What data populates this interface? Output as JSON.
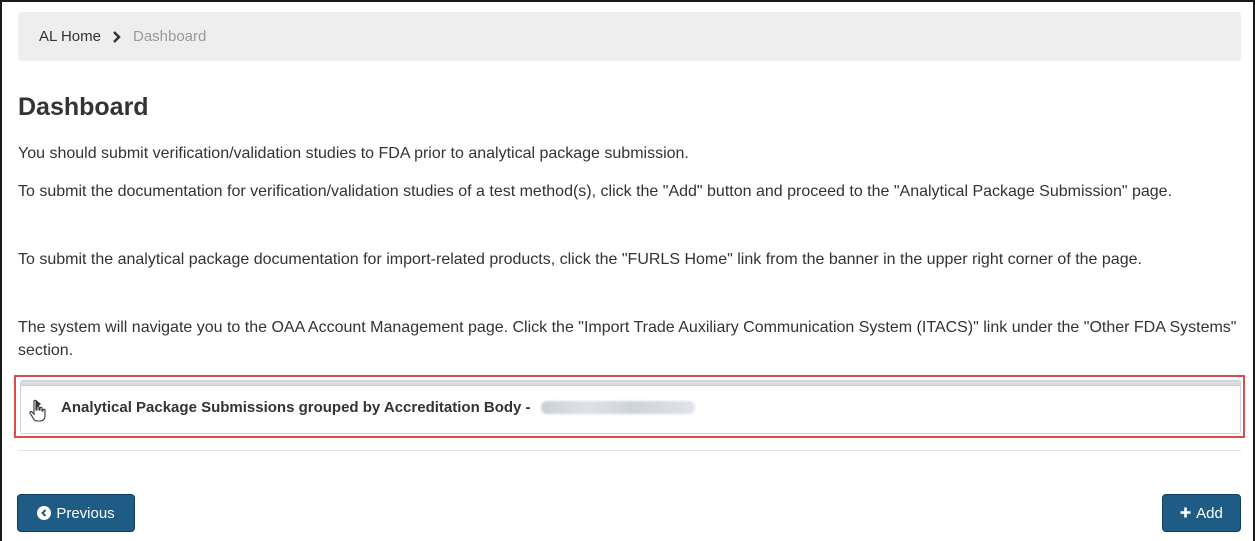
{
  "breadcrumb": {
    "home": "AL Home",
    "current": "Dashboard"
  },
  "page": {
    "title": "Dashboard",
    "paragraphs": [
      "You should submit verification/validation studies to FDA prior to analytical package submission.",
      "To submit the documentation for verification/validation studies of a test method(s), click the \"Add\" button and proceed to the \"Analytical Package Submission\" page.",
      "To submit the analytical package documentation for import-related products, click the \"FURLS Home\" link from the banner in the upper right corner of the page.",
      "The system will navigate you to the OAA Account Management page. Click the \"Import Trade Auxiliary Communication System (ITACS)\" link under the \"Other FDA Systems\" section."
    ]
  },
  "panel": {
    "title": "Analytical Package Submissions grouped by Accreditation Body -"
  },
  "buttons": {
    "previous": "Previous",
    "add": "Add"
  },
  "colors": {
    "primary_button": "#1e5c86",
    "highlight_outline": "#e04a4a"
  }
}
